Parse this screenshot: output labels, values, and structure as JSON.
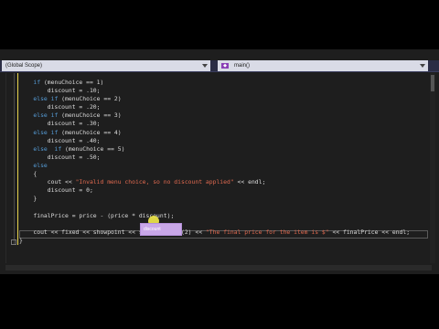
{
  "scope_bar": {
    "left_label": "(Global Scope)",
    "right_label": "main()",
    "right_icon": "function-icon"
  },
  "tooltip": {
    "text": "discount"
  },
  "colors": {
    "keyword": "#569cd6",
    "string": "#e06a50",
    "text": "#dcdcdc",
    "cursor_highlight": "#f2ea4a",
    "margin_bar": "#e8d44d"
  },
  "code": {
    "lines": [
      {
        "indent": "    ",
        "kw": "if",
        "rest": " (menuChoice == 1)"
      },
      {
        "indent": "        ",
        "kw": "",
        "rest": "discount = .10;"
      },
      {
        "indent": "    ",
        "kw": "else if",
        "rest": " (menuChoice == 2)"
      },
      {
        "indent": "        ",
        "kw": "",
        "rest": "discount = .20;"
      },
      {
        "indent": "    ",
        "kw": "else if",
        "rest": " (menuChoice == 3)"
      },
      {
        "indent": "        ",
        "kw": "",
        "rest": "discount = .30;"
      },
      {
        "indent": "    ",
        "kw": "else if",
        "rest": " (menuChoice == 4)"
      },
      {
        "indent": "        ",
        "kw": "",
        "rest": "discount = .40;"
      },
      {
        "indent": "    ",
        "kw": "else  if",
        "rest": " (menuChoice == 5)"
      },
      {
        "indent": "        ",
        "kw": "",
        "rest": "discount = .50;"
      },
      {
        "indent": "    ",
        "kw": "else",
        "rest": ""
      },
      {
        "indent": "    ",
        "kw": "",
        "rest": "{"
      },
      {
        "indent": "        ",
        "kw": "",
        "rest": "cout << ",
        "str": "\"Invalid menu choice, so no discount applied\"",
        "tail": " << endl;"
      },
      {
        "indent": "        ",
        "kw": "",
        "rest": "discount = 0;"
      },
      {
        "indent": "    ",
        "kw": "",
        "rest": "}"
      },
      {
        "indent": "",
        "kw": "",
        "rest": ""
      },
      {
        "indent": "    ",
        "kw": "",
        "rest": "finalPrice = price - (price * discount);"
      },
      {
        "indent": "",
        "kw": "",
        "rest": ""
      },
      {
        "indent": "    ",
        "kw": "",
        "rest": "cout << fixed << showpoint << setprecision(2) << ",
        "str": "\"The final price for the item is $\"",
        "tail": " << finalPrice << endl;"
      },
      {
        "indent": "",
        "kw": "",
        "rest": "}"
      }
    ]
  }
}
